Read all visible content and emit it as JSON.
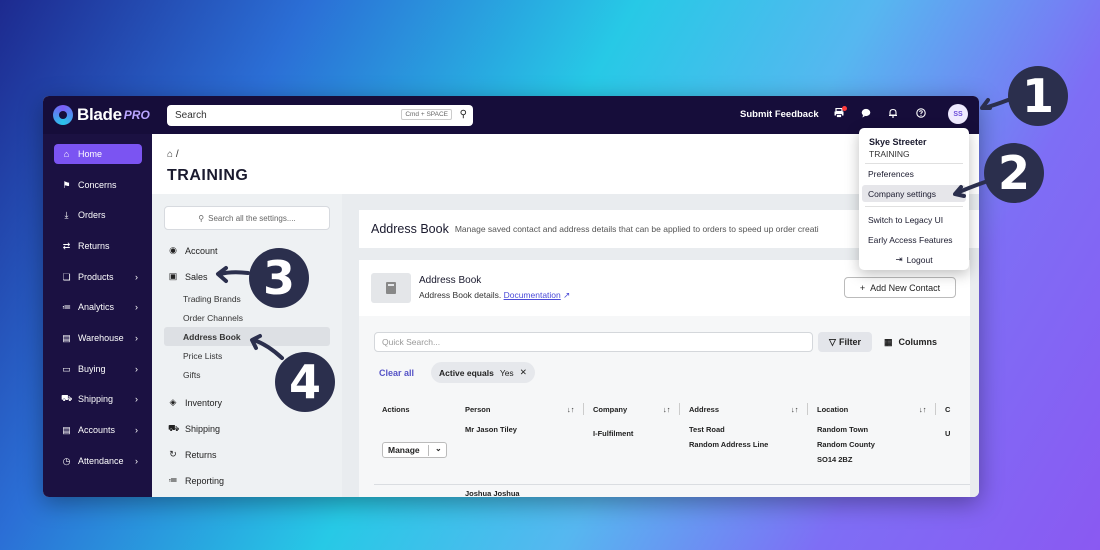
{
  "app": {
    "logo_text": "Blade",
    "logo_suffix": "PRO",
    "brand_color": "#7b54f2"
  },
  "topbar": {
    "search_placeholder": "Search",
    "search_shortcut": "Cmd + SPACE",
    "submit_feedback": "Submit Feedback",
    "avatar_initials": "SS"
  },
  "sidebar": {
    "items": [
      {
        "label": "Home",
        "icon": "home-icon",
        "active": true
      },
      {
        "label": "Concerns",
        "icon": "flag-icon"
      },
      {
        "label": "Orders",
        "icon": "download-icon"
      },
      {
        "label": "Returns",
        "icon": "swap-icon"
      },
      {
        "label": "Products",
        "icon": "box-icon",
        "expandable": true
      },
      {
        "label": "Analytics",
        "icon": "chart-icon",
        "expandable": true
      },
      {
        "label": "Warehouse",
        "icon": "warehouse-icon",
        "expandable": true
      },
      {
        "label": "Buying",
        "icon": "card-icon",
        "expandable": true
      },
      {
        "label": "Shipping",
        "icon": "truck-icon",
        "expandable": true
      },
      {
        "label": "Accounts",
        "icon": "wallet-icon",
        "expandable": true
      },
      {
        "label": "Attendance",
        "icon": "clock-icon",
        "expandable": true
      }
    ]
  },
  "header": {
    "breadcrumb": "/",
    "title": "TRAINING"
  },
  "settings": {
    "search_placeholder": "Search all the settings....",
    "sections": {
      "account": "Account",
      "sales": "Sales",
      "inventory": "Inventory",
      "shipping": "Shipping",
      "returns": "Returns",
      "reporting": "Reporting"
    },
    "sales_sub": [
      "Trading Brands",
      "Order Channels",
      "Address Book",
      "Price Lists",
      "Gifts"
    ]
  },
  "address_book": {
    "title": "Address Book",
    "description": "Manage saved contact and address details that can be applied to orders to speed up order creati",
    "card_title": "Address Book",
    "card_subtitle": "Address Book details.",
    "doc_link": "Documentation",
    "add_button": "Add New Contact",
    "quick_search": "Quick Search...",
    "filter_label": "Filter",
    "columns_label": "Columns",
    "clear_all": "Clear all",
    "chip_field": "Active equals",
    "chip_value": "Yes",
    "columns": [
      "Actions",
      "Person",
      "Company",
      "Address",
      "Location",
      "C"
    ],
    "rows": [
      {
        "action": "Manage",
        "person": "Mr Jason Tiley",
        "company": "I-Fulfilment",
        "address1": "Test Road",
        "address2": "Random Address Line",
        "loc1": "Random Town",
        "loc2": "Random County",
        "loc3": "SO14 2BZ",
        "extra": "U"
      },
      {
        "person": "Joshua Joshua"
      }
    ]
  },
  "user_menu": {
    "name": "Skye Streeter",
    "org": "TRAINING",
    "items": [
      "Preferences",
      "Company settings",
      "Switch to Legacy UI",
      "Early Access Features",
      "Logout"
    ]
  },
  "callouts": [
    "1",
    "2",
    "3",
    "4"
  ]
}
